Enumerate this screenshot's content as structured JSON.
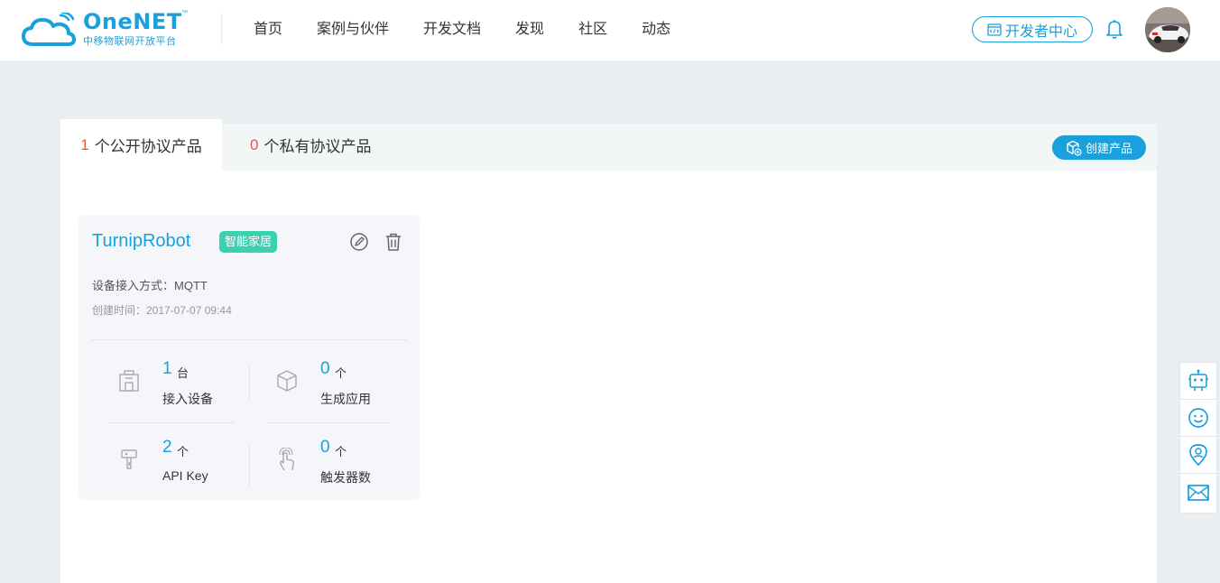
{
  "brand": {
    "name": "OneNET",
    "tm": "™",
    "subtitle": "中移物联网开放平台",
    "color": "#1aa0dc"
  },
  "nav": {
    "items": [
      {
        "label": "首页"
      },
      {
        "label": "案例与伙伴"
      },
      {
        "label": "开发文档"
      },
      {
        "label": "发现"
      },
      {
        "label": "社区"
      },
      {
        "label": "动态"
      }
    ]
  },
  "header": {
    "dev_center_label": "开发者中心",
    "bell_icon": "bell-icon",
    "avatar_icon": "user-avatar"
  },
  "tabs": {
    "public": {
      "count": "1",
      "label": "个公开协议产品"
    },
    "private": {
      "count": "0",
      "label": "个私有协议产品"
    }
  },
  "actions": {
    "create_product_label": "创建产品"
  },
  "product": {
    "name": "TurnipRobot",
    "tag": "智能家居",
    "access_method": "设备接入方式：MQTT",
    "created": "创建时间：2017-07-07 09:44",
    "stats": [
      {
        "value": "1",
        "unit": "台",
        "label": "接入设备",
        "icon": "device-icon"
      },
      {
        "value": "0",
        "unit": "个",
        "label": "生成应用",
        "icon": "cube-icon"
      },
      {
        "value": "2",
        "unit": "个",
        "label": "API Key",
        "icon": "key-icon"
      },
      {
        "value": "0",
        "unit": "个",
        "label": "触发器数",
        "icon": "touch-icon"
      }
    ]
  },
  "floating_bar": [
    "robot-icon",
    "smile-icon",
    "location-icon",
    "mail-icon"
  ],
  "colors": {
    "accent": "#1aa0dc",
    "count_red": "#e4554a",
    "tag_green": "#3ad1b1",
    "page_bg": "#eaeef1"
  }
}
